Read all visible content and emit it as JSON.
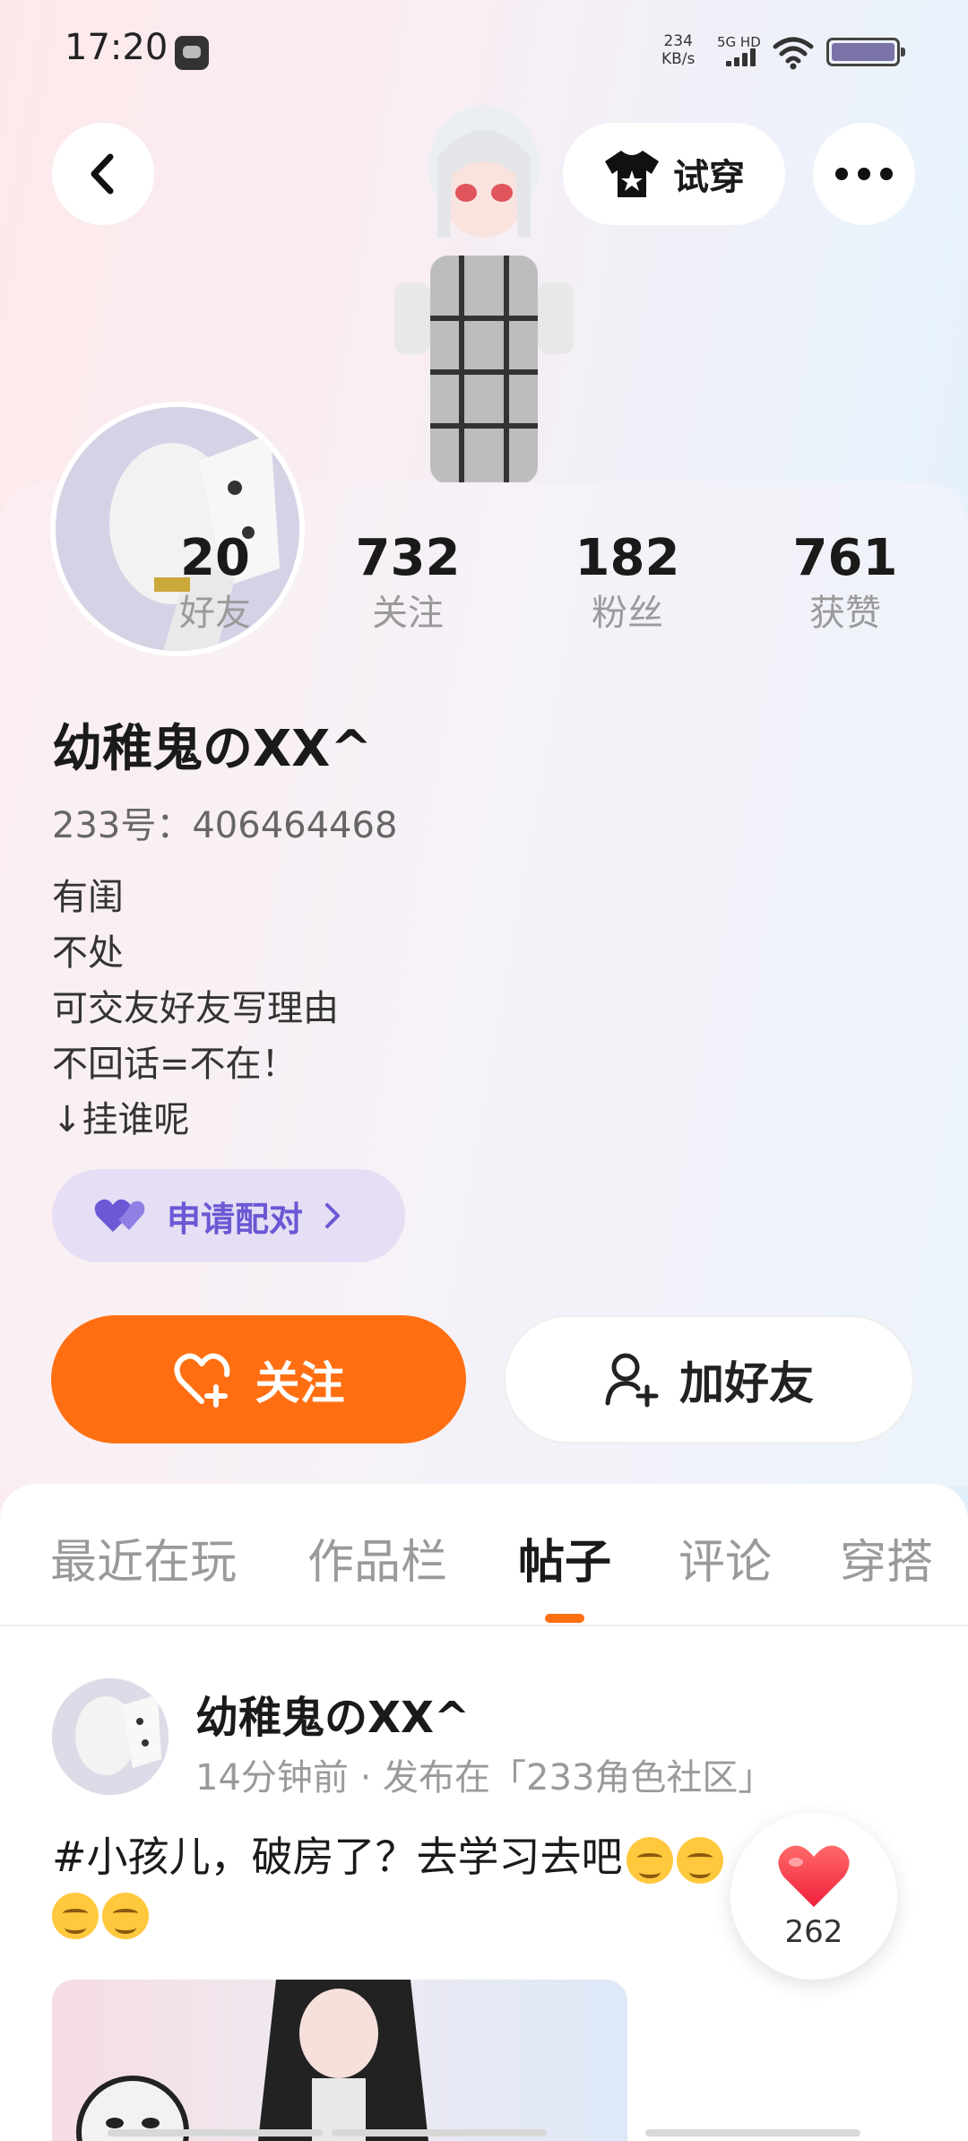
{
  "status_bar": {
    "time": "17:20",
    "net_speed_value": "234",
    "net_speed_unit": "KB/s",
    "network": "5G HD"
  },
  "header": {
    "back_icon": "chevron-left-icon",
    "tryon_label": "试穿",
    "tryon_icon": "tshirt-icon",
    "more_icon": "more-dots-icon"
  },
  "profile": {
    "stats": [
      {
        "value": "20",
        "label": "好友"
      },
      {
        "value": "732",
        "label": "关注"
      },
      {
        "value": "182",
        "label": "粉丝"
      },
      {
        "value": "761",
        "label": "获赞"
      }
    ],
    "nickname": "幼稚鬼のXX^",
    "uid": "233号：406464468",
    "bio_lines": [
      "有闺",
      "不处",
      "可交友好友写理由",
      "不回话=不在！",
      "↓挂谁呢"
    ],
    "pair_label": "申请配对",
    "pair_color": "#6a58d4"
  },
  "actions": {
    "follow_label": "关注",
    "add_friend_label": "加好友",
    "accent": "#ff6f12"
  },
  "tabs": [
    "最近在玩",
    "作品栏",
    "帖子",
    "评论",
    "穿搭"
  ],
  "active_tab": "帖子",
  "post": {
    "author": "幼稚鬼のXX^",
    "meta": "14分钟前 · 发布在「233角色社区」",
    "text": "#小孩儿，破房了？去学习去吧",
    "like_count": "262"
  }
}
